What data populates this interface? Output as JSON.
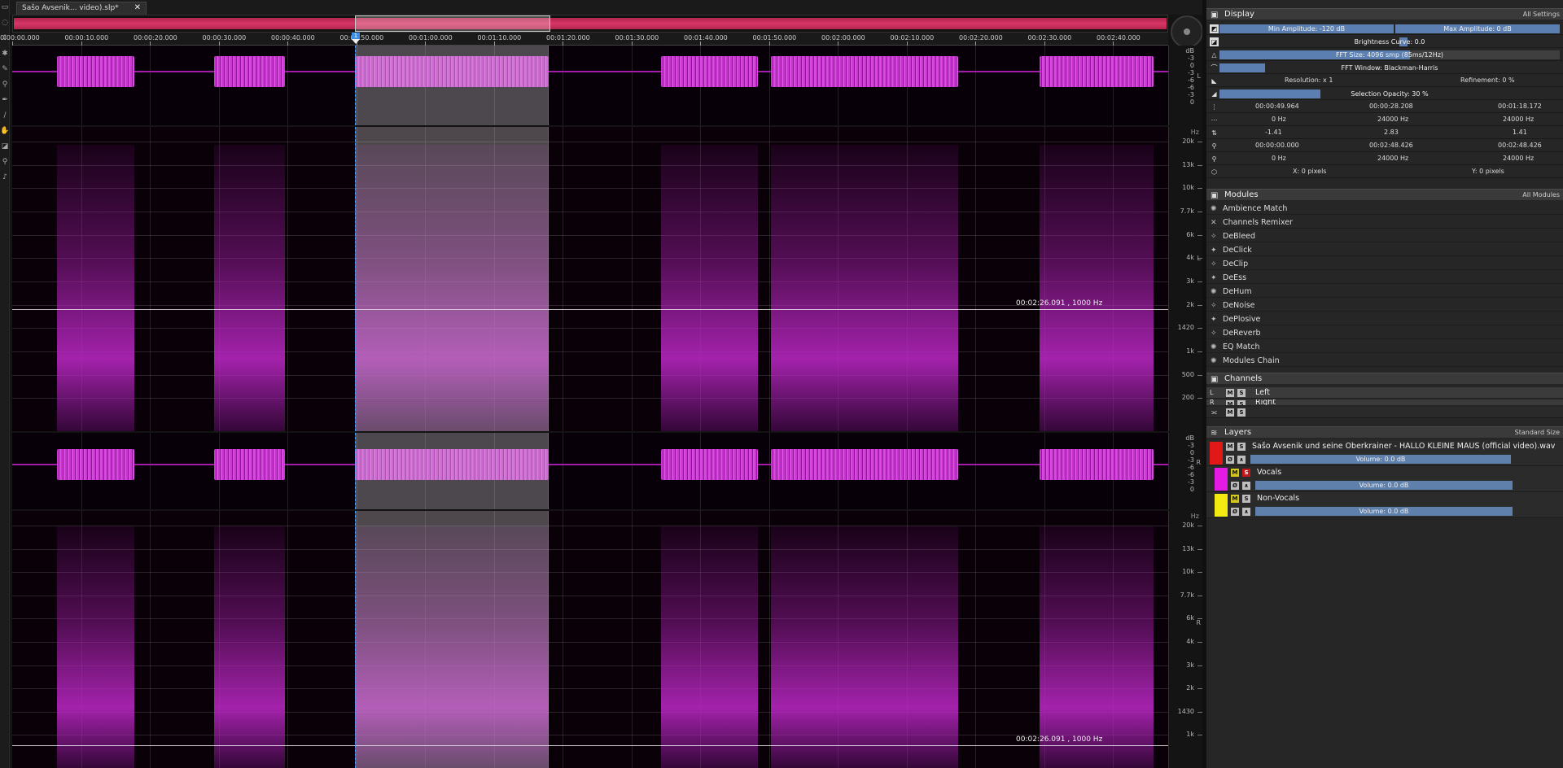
{
  "tab": {
    "title": "Sašo Avsenik... video).slp*",
    "close": "✕"
  },
  "ruler": {
    "ticks": [
      "00:00:00.000",
      "00:00:10.000",
      "00:00:20.000",
      "00:00:30.000",
      "00:00:40.000",
      "00:00:50.000",
      "00:01:00.000",
      "00:01:10.000",
      "00:01:20.000",
      "00:01:30.000",
      "00:01:40.000",
      "00:01:50.000",
      "00:02:00.000",
      "00:02:10.000",
      "00:02:20.000",
      "00:02:30.000",
      "00:02:40.000"
    ]
  },
  "playhead": {
    "label": "1"
  },
  "tracks": {
    "top_wave_scale": [
      "dB",
      "-3",
      "0",
      "-3",
      "-6",
      "-6",
      "-3",
      "0"
    ],
    "channel_left": "L",
    "channel_right": "R",
    "freq_unit": "Hz",
    "freq_labels": [
      "20k",
      "13k",
      "10k",
      "7.7k",
      "6k",
      "4k",
      "3k",
      "2k",
      "1420",
      "1k",
      "500",
      "200"
    ],
    "freq_labels_lower": [
      "20k",
      "13k",
      "10k",
      "7.7k",
      "6k",
      "4k",
      "3k",
      "2k",
      "1430",
      "1k"
    ],
    "cursor_readout": "00:02:26.091 , 1000 Hz"
  },
  "display": {
    "title": "Display",
    "settings_link": "All Settings",
    "min_amp": "Min Amplitude: -120 dB",
    "max_amp": "Max Amplitude: 0 dB",
    "brightness": "Brightness Curve: 0.0",
    "fft_size": "FFT Size: 4096 smp (85ms/12Hz)",
    "fft_window": "FFT Window: Blackman-Harris",
    "resolution": "Resolution: x 1",
    "refinement": "Refinement: 0 %",
    "selection_opacity": "Selection Opacity: 30 %",
    "rows": [
      [
        "00:00:49.964",
        "00:00:28.208",
        "00:01:18.172"
      ],
      [
        "0  Hz",
        "24000  Hz",
        "24000  Hz"
      ],
      [
        "-1.41",
        "2.83",
        "1.41"
      ],
      [
        "00:00:00.000",
        "00:02:48.426",
        "00:02:48.426"
      ],
      [
        "0  Hz",
        "24000  Hz",
        "24000  Hz"
      ]
    ],
    "x_pixels": "X: 0 pixels",
    "y_pixels": "Y: 0 pixels"
  },
  "modules": {
    "title": "Modules",
    "filter": "All Modules",
    "items": [
      "Ambience Match",
      "Channels Remixer",
      "DeBleed",
      "DeClick",
      "DeClip",
      "DeEss",
      "DeHum",
      "DeNoise",
      "DePlosive",
      "DeReverb",
      "EQ Match",
      "Modules Chain"
    ]
  },
  "channels": {
    "title": "Channels",
    "items": [
      {
        "letter": "L",
        "name": "Left"
      },
      {
        "letter": "R",
        "name": "Right"
      }
    ]
  },
  "layers": {
    "title": "Layers",
    "size_mode": "Standard Size",
    "items": [
      {
        "name": "Sašo Avsenik und seine Oberkrainer - HALLO KLEINE MAUS (official video).wav",
        "volume": "Volume: 0.0 dB",
        "color": "#e01818"
      },
      {
        "name": "Vocals",
        "volume": "Volume: 0.0 dB",
        "color": "#e51be5"
      },
      {
        "name": "Non-Vocals",
        "volume": "Volume: 0.0 dB",
        "color": "#f2ea10"
      }
    ]
  },
  "buttons": {
    "mute": "M",
    "solo": "S",
    "phase": "Ø",
    "link": "∧"
  }
}
